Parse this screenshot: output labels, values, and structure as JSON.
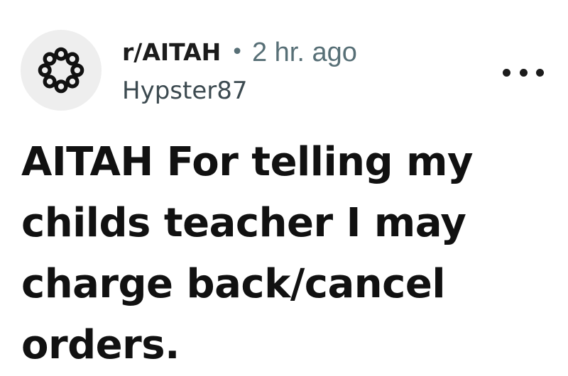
{
  "post": {
    "subreddit": "r/AITAH",
    "separator": "•",
    "time_ago": "2 hr. ago",
    "author": "Hypster87",
    "title": "AITAH For telling my childs teacher I may charge back/cancel orders."
  },
  "icons": {
    "avatar": "subreddit-ring-icon",
    "menu": "more-options-icon"
  },
  "colors": {
    "avatar_bg": "#eeeeee",
    "meta_text": "#576f76",
    "title_text": "#111111"
  }
}
